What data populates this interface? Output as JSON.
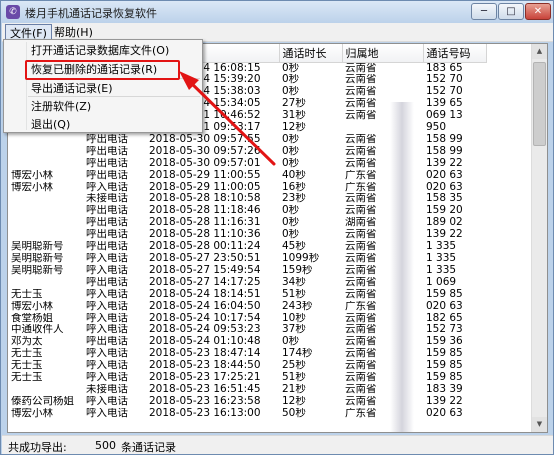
{
  "window": {
    "title": "楼月手机通话记录恢复软件",
    "app_icon_glyph": "✆",
    "minimize_glyph": "─",
    "maximize_glyph": "□",
    "close_glyph": "✕"
  },
  "menubar": {
    "file": "文件(F)",
    "help": "帮助(H)"
  },
  "file_menu": {
    "open": "打开通话记录数据库文件(O)",
    "restore": "恢复已删除的通话记录(R)",
    "export": "导出通话记录(E)",
    "register": "注册软件(Z)",
    "exit": "退出(Q)"
  },
  "table": {
    "columns": [
      "",
      "",
      "",
      "通话时长",
      "归属地",
      "通话号码"
    ],
    "rows": [
      [
        "",
        "",
        "2018-06-04 16:08:15",
        "0秒",
        "云南省",
        "183 65"
      ],
      [
        "",
        "",
        "2018-06-04 15:39:20",
        "0秒",
        "云南省",
        "152 70"
      ],
      [
        "",
        "",
        "2018-06-04 15:38:03",
        "0秒",
        "云南省",
        "152 70"
      ],
      [
        "",
        "",
        "2018-06-04 15:34:05",
        "27秒",
        "云南省",
        "139 65"
      ],
      [
        "",
        "",
        "2018-06-01 10:46:52",
        "31秒",
        "云南省",
        "069 13"
      ],
      [
        "",
        "未接电话",
        "2018-06-01 09:53:17",
        "12秒",
        "",
        "950"
      ],
      [
        "",
        "呼出电话",
        "2018-05-30 09:57:55",
        "0秒",
        "云南省",
        "158 99"
      ],
      [
        "",
        "呼出电话",
        "2018-05-30 09:57:26",
        "0秒",
        "云南省",
        "158 99"
      ],
      [
        "",
        "呼出电话",
        "2018-05-30 09:57:01",
        "0秒",
        "云南省",
        "139 22"
      ],
      [
        "博宏小林",
        "呼出电话",
        "2018-05-29 11:00:55",
        "40秒",
        "广东省",
        "020 63"
      ],
      [
        "博宏小林",
        "呼入电话",
        "2018-05-29 11:00:05",
        "16秒",
        "广东省",
        "020 63"
      ],
      [
        "",
        "未接电话",
        "2018-05-28 18:10:58",
        "23秒",
        "云南省",
        "158 35"
      ],
      [
        "",
        "呼出电话",
        "2018-05-28 11:18:46",
        "0秒",
        "云南省",
        "159 20"
      ],
      [
        "",
        "呼出电话",
        "2018-05-28 11:16:31",
        "0秒",
        "湖南省",
        "189 02"
      ],
      [
        "",
        "呼出电话",
        "2018-05-28 11:10:36",
        "0秒",
        "云南省",
        "139 22"
      ],
      [
        "吴明聪新号",
        "呼出电话",
        "2018-05-28 00:11:24",
        "45秒",
        "云南省",
        "1 335"
      ],
      [
        "吴明聪新号",
        "呼入电话",
        "2018-05-27 23:50:51",
        "1099秒",
        "云南省",
        "1 335"
      ],
      [
        "吴明聪新号",
        "呼入电话",
        "2018-05-27 15:49:54",
        "159秒",
        "云南省",
        "1 335"
      ],
      [
        "",
        "呼出电话",
        "2018-05-27 14:17:25",
        "34秒",
        "云南省",
        "1 069"
      ],
      [
        "无士玉",
        "呼入电话",
        "2018-05-24 18:14:51",
        "51秒",
        "云南省",
        "159 85"
      ],
      [
        "博宏小林",
        "呼入电话",
        "2018-05-24 16:04:50",
        "243秒",
        "广东省",
        "020 63"
      ],
      [
        "食堂杨姐",
        "呼入电话",
        "2018-05-24 10:17:54",
        "10秒",
        "云南省",
        "182 65"
      ],
      [
        "中通收件人",
        "呼入电话",
        "2018-05-24 09:53:23",
        "37秒",
        "云南省",
        "152 73"
      ],
      [
        "邓为太",
        "呼出电话",
        "2018-05-24 01:10:48",
        "0秒",
        "云南省",
        "159 36"
      ],
      [
        "无士玉",
        "呼入电话",
        "2018-05-23 18:47:14",
        "174秒",
        "云南省",
        "159 85"
      ],
      [
        "无士玉",
        "呼入电话",
        "2018-05-23 18:44:50",
        "25秒",
        "云南省",
        "159 85"
      ],
      [
        "无士玉",
        "呼入电话",
        "2018-05-23 17:25:21",
        "51秒",
        "云南省",
        "159 85"
      ],
      [
        "",
        "未接电话",
        "2018-05-23 16:51:45",
        "21秒",
        "云南省",
        "183 39"
      ],
      [
        "傣药公司杨姐",
        "呼入电话",
        "2018-05-23 16:23:58",
        "12秒",
        "云南省",
        "139 22"
      ],
      [
        "博宏小林",
        "呼入电话",
        "2018-05-23 16:13:00",
        "50秒",
        "广东省",
        "020 63"
      ]
    ]
  },
  "statusbar": {
    "text": "共成功导出:",
    "count": "500",
    "unit": "条通话记录"
  },
  "colors": {
    "highlight": "#e21414",
    "title_gradient_top": "#dbe8f6",
    "title_gradient_bottom": "#bcd2ea"
  }
}
